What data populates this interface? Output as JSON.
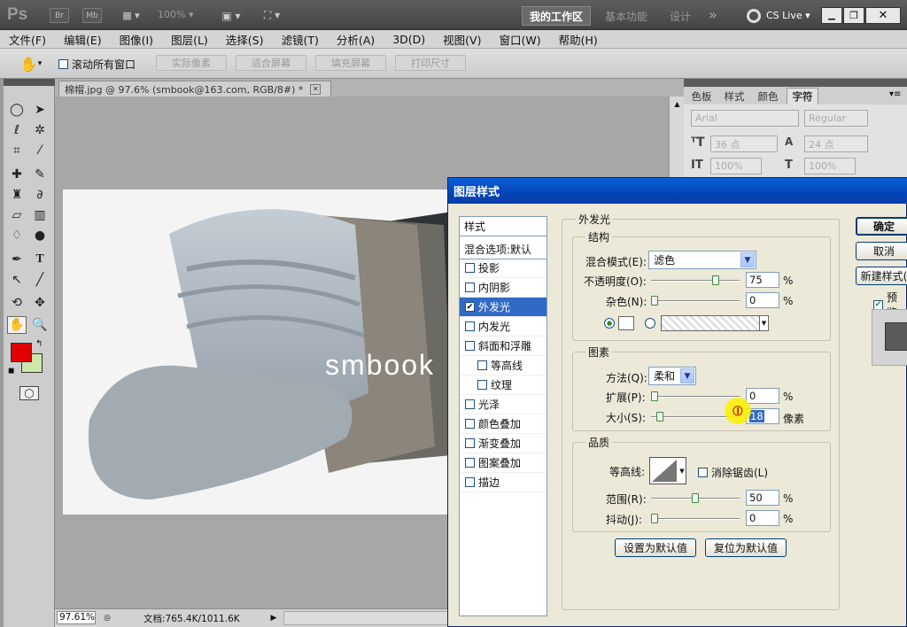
{
  "appbar": {
    "logo": "Ps",
    "bridge": "Br",
    "minibridge": "Mb",
    "zoom": "100%",
    "workspaces": [
      "我的工作区",
      "基本功能",
      "设计"
    ],
    "more": "»",
    "cslive": "CS Live"
  },
  "menu": [
    "文件(F)",
    "编辑(E)",
    "图像(I)",
    "图层(L)",
    "选择(S)",
    "滤镜(T)",
    "分析(A)",
    "3D(D)",
    "视图(V)",
    "窗口(W)",
    "帮助(H)"
  ],
  "options": {
    "scroll_all": "滚动所有窗口",
    "buttons": [
      "实际像素",
      "适合屏幕",
      "填充屏幕",
      "打印尺寸"
    ]
  },
  "document": {
    "tab_title": "棉帽.jpg @ 97.6% (smbook@163.com, RGB/8#) *",
    "watermark": "smbook",
    "zoom": "97.61%",
    "docinfo": "文档:765.4K/1011.6K"
  },
  "panel": {
    "tabs": [
      "色板",
      "样式",
      "颜色",
      "字符"
    ],
    "font_family": "Arial",
    "font_style": "Regular",
    "font_size": "36 点",
    "leading": "24 点",
    "vscale": "100%",
    "hscale": "100%"
  },
  "dialog": {
    "title": "图层样式",
    "styles_header": "样式",
    "blend_options": "混合选项:默认",
    "styles": [
      {
        "label": "投影",
        "checked": false
      },
      {
        "label": "内阴影",
        "checked": false
      },
      {
        "label": "外发光",
        "checked": true
      },
      {
        "label": "内发光",
        "checked": false
      },
      {
        "label": "斜面和浮雕",
        "checked": false
      },
      {
        "label": "等高线",
        "checked": false
      },
      {
        "label": "纹理",
        "checked": false
      },
      {
        "label": "光泽",
        "checked": false
      },
      {
        "label": "颜色叠加",
        "checked": false
      },
      {
        "label": "渐变叠加",
        "checked": false
      },
      {
        "label": "图案叠加",
        "checked": false
      },
      {
        "label": "描边",
        "checked": false
      }
    ],
    "section_title": "外发光",
    "structure": {
      "title": "结构",
      "blend_mode_label": "混合模式(E):",
      "blend_mode": "滤色",
      "opacity_label": "不透明度(O):",
      "opacity": "75",
      "opacity_pct": 0.75,
      "noise_label": "杂色(N):",
      "noise": "0",
      "noise_pct": 0,
      "unit": "%"
    },
    "elements": {
      "title": "图素",
      "technique_label": "方法(Q):",
      "technique": "柔和",
      "spread_label": "扩展(P):",
      "spread": "0",
      "spread_pct": 0,
      "size_label": "大小(S):",
      "size": "18",
      "size_pct": 0.07,
      "unit_pct": "%",
      "unit_px": "像素"
    },
    "quality": {
      "title": "品质",
      "contour_label": "等高线:",
      "antialias_label": "消除锯齿(L)",
      "range_label": "范围(R):",
      "range": "50",
      "range_pct": 0.5,
      "jitter_label": "抖动(J):",
      "jitter": "0",
      "jitter_pct": 0,
      "unit": "%"
    },
    "make_default": "设置为默认值",
    "reset_default": "复位为默认值",
    "ok": "确定",
    "cancel": "取消",
    "new_style": "新建样式(",
    "preview": "预览"
  },
  "colors": {
    "foreground": "#e00000",
    "background": "#cde8a8",
    "workspace_active": "#6a6a6a",
    "dialog_title": "#0a5fd9"
  }
}
